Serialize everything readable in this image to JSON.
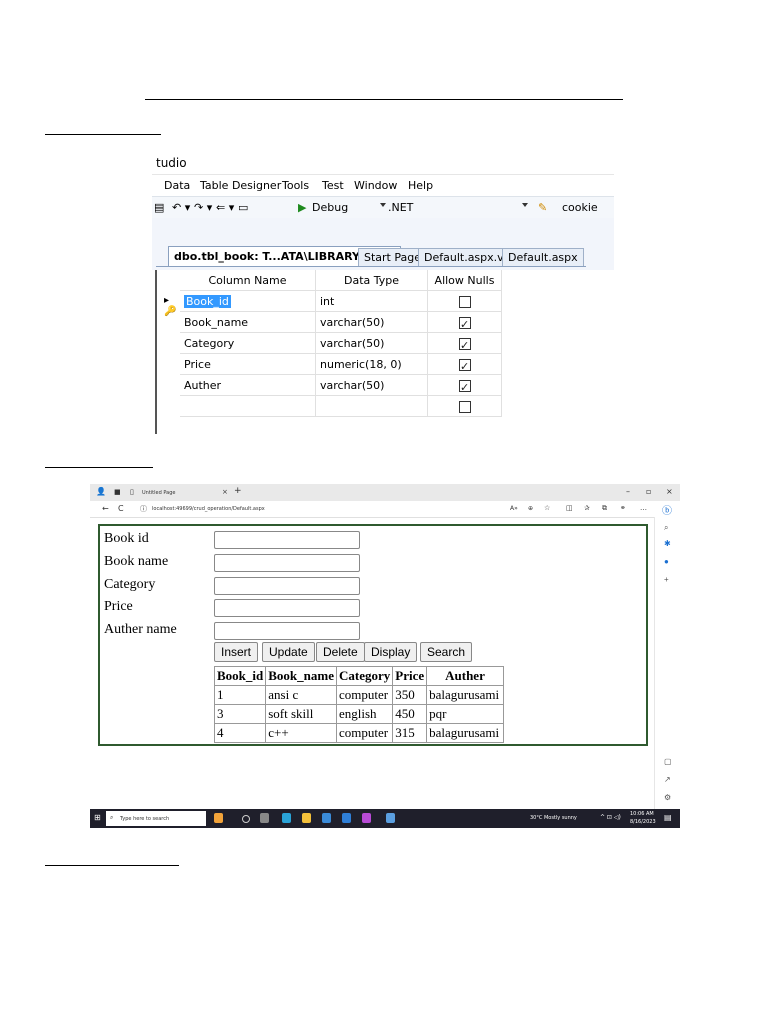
{
  "vs_window": {
    "title_fragment": "tudio",
    "menu": [
      "Data",
      "Table Designer",
      "Tools",
      "Test",
      "Window",
      "Help"
    ],
    "toolbar": {
      "config": "Debug",
      "platform": ".NET",
      "search_value": "cookie"
    },
    "tabs": [
      "dbo.tbl_book: T...ATA\\LIBRARY.MDF)",
      "Start Page",
      "Default.aspx.vb",
      "Default.aspx"
    ],
    "grid": {
      "headers": [
        "Column Name",
        "Data Type",
        "Allow Nulls"
      ],
      "rows": [
        {
          "name": "Book_id",
          "type": "int",
          "nulls": false
        },
        {
          "name": "Book_name",
          "type": "varchar(50)",
          "nulls": true
        },
        {
          "name": "Category",
          "type": "varchar(50)",
          "nulls": true
        },
        {
          "name": "Price",
          "type": "numeric(18, 0)",
          "nulls": true
        },
        {
          "name": "Auther",
          "type": "varchar(50)",
          "nulls": true
        },
        {
          "name": "",
          "type": "",
          "nulls": false
        }
      ]
    }
  },
  "browser": {
    "tab_title": "Untitled Page",
    "url": "localhost:49699/crud_operation/Default.aspx",
    "form": {
      "labels": [
        "Book id",
        "Book name",
        "Category",
        "Price",
        "Auther name"
      ],
      "buttons": [
        "Insert",
        "Update",
        "Delete",
        "Display",
        "Search"
      ]
    },
    "results": {
      "headers": [
        "Book_id",
        "Book_name",
        "Category",
        "Price",
        "Auther"
      ],
      "rows": [
        [
          "1",
          "ansi c",
          "computer",
          "350",
          "balagurusami"
        ],
        [
          "3",
          "soft skill",
          "english",
          "450",
          "pqr"
        ],
        [
          "4",
          "c++",
          "computer",
          "315",
          "balagurusami"
        ]
      ]
    },
    "taskbar": {
      "search_placeholder": "Type here to search",
      "weather": "30°C  Mostly sunny",
      "time": "10:06 AM",
      "date": "8/16/2023"
    }
  },
  "colors": {
    "form_border": "#2f5a2f",
    "selection": "#3399ff",
    "taskbar": "#1f1f2b"
  }
}
